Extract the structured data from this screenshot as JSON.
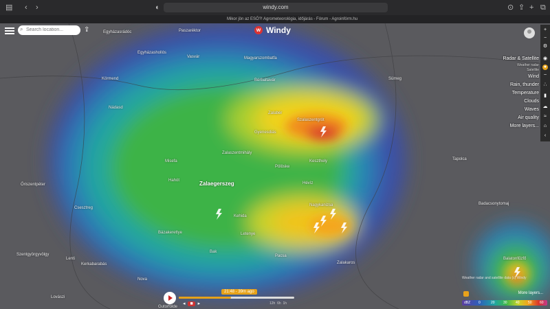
{
  "browser": {
    "url": "windy.com",
    "tab_text": "Mikor jön az ESŐ?! Agrometeorológia, időjárás - Fórum - Agroinfórm.hu"
  },
  "header": {
    "search_placeholder": "Search location...",
    "logo_text": "Windy"
  },
  "places": [
    "Egyházasrádóc",
    "Paszaréktor",
    "Egyházashollós",
    "Vasvár",
    "Magyarszombatfa",
    "Körmend",
    "Nádasd",
    "Bérbaltavár",
    "Szalaszentgrót",
    "Zalabér",
    "Gyenesdiás",
    "Zalaegerszeg",
    "Keszthely",
    "Hévíz",
    "Sümeg",
    "Tapolca",
    "Nagykanizsa",
    "Pacsa",
    "Badacsonytomaj",
    "Kehida",
    "Zalaszentmihály",
    "Bak",
    "Letenye",
    "Nova",
    "Kerkabarabás",
    "Szentgyörgyvölgy",
    "Lenti",
    "Gutorfölde",
    "Bázakerettye",
    "Balatonfűzfő",
    "Hahót",
    "Zalakaros",
    "Csesztreg",
    "Lovászi",
    "Őriszentpéter",
    "Pölöske",
    "Misefa"
  ],
  "right_panel": {
    "items": [
      "Radar & Satellite",
      "Weather radar",
      "Satellite",
      "Wind",
      "Rain, thunder",
      "Temperature",
      "Clouds",
      "Waves",
      "Air quality",
      "More layers..."
    ]
  },
  "timeline": {
    "time_label": "21:48 - 39m ago",
    "ticks": [
      "12h",
      "6h",
      "1h"
    ],
    "progress": 0.45
  },
  "legend": {
    "unit": "dBZ",
    "values": [
      "0",
      "20",
      "30",
      "40",
      "50",
      "60"
    ],
    "more_layers": "More layers...",
    "info": "Weather radar and satellite data (c) Windy"
  },
  "colors": {
    "accent_red": "#d33333",
    "timeline_badge": "#e6a21a"
  }
}
